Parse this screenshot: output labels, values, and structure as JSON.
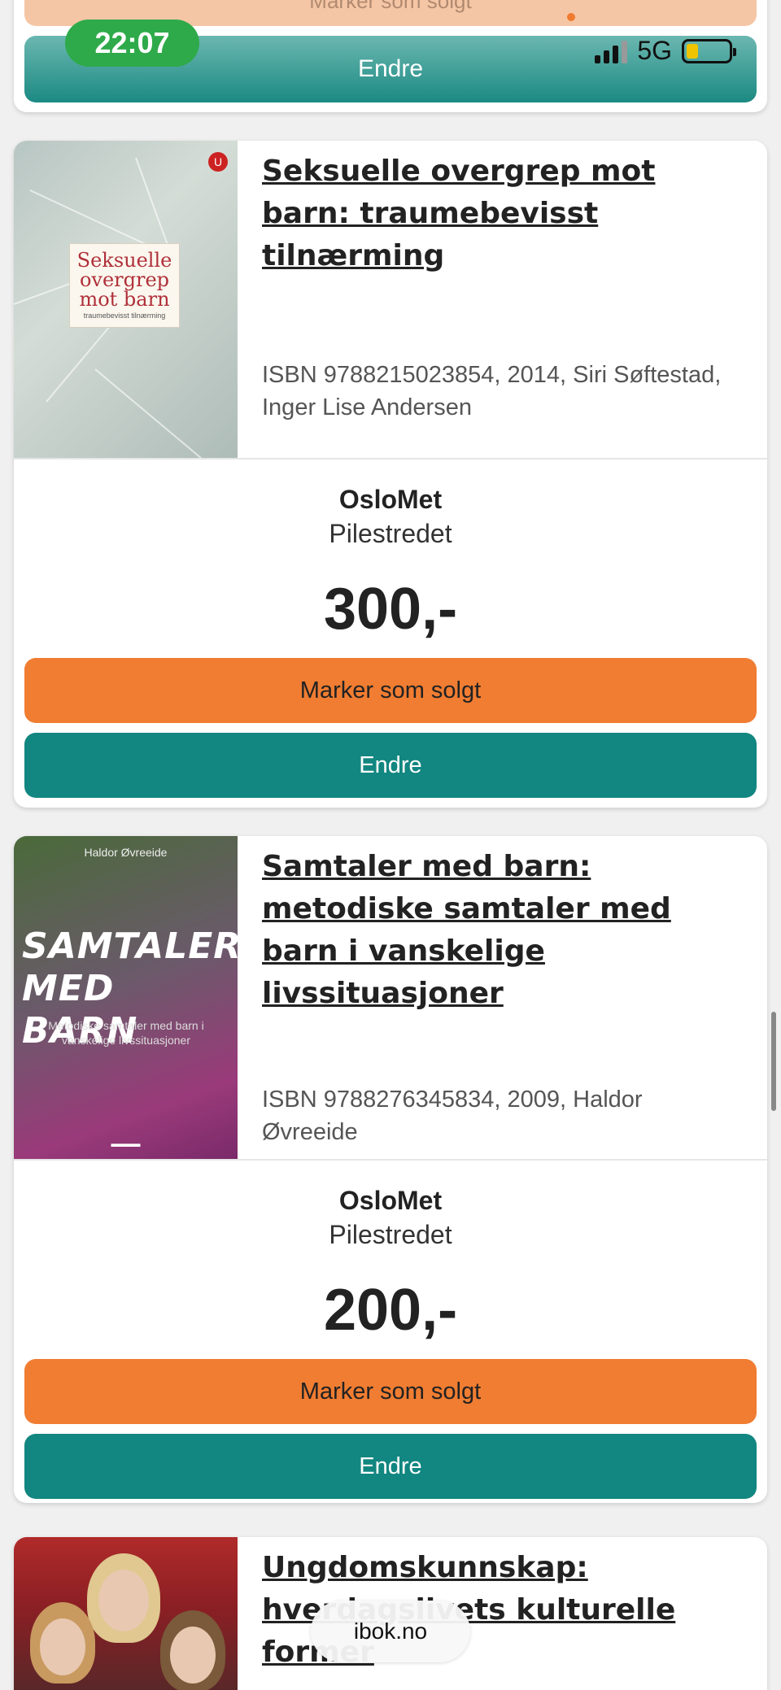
{
  "status_bar": {
    "time": "22:07",
    "network": "5G"
  },
  "top_card": {
    "sold_label": "Marker som solgt",
    "edit_label": "Endre"
  },
  "listings": [
    {
      "title": "Seksuelle overgrep mot barn: traumebevisst tilnærming",
      "meta": "ISBN 9788215023854, 2014, Siri Søftestad, Inger Lise Andersen",
      "school": "OsloMet",
      "campus": "Pilestredet",
      "price": "300,-",
      "sold_label": "Marker som solgt",
      "edit_label": "Endre",
      "cover": {
        "words": [
          "Seksuelle",
          "overgrep",
          "mot barn"
        ],
        "subtitle": "traumebevisst tilnærming"
      }
    },
    {
      "title": "Samtaler med barn: metodiske samtaler med barn i vanskelige livssituasjoner",
      "meta": "ISBN 9788276345834, 2009, Haldor Øvreeide",
      "school": "OsloMet",
      "campus": "Pilestredet",
      "price": "200,-",
      "sold_label": "Marker som solgt",
      "edit_label": "Endre",
      "cover": {
        "author": "Haldor Øvreeide",
        "line1": "SAMTALER",
        "line2": "MED BARN",
        "subtitle": "Metodiske samtaler med barn i vanskelige livssituasjoner"
      }
    },
    {
      "title": "Ungdomskunnskap: hverdagslivets kulturelle former"
    }
  ],
  "site": "ibok.no",
  "colors": {
    "orange": "#f07d32",
    "teal": "#128680",
    "status_green": "#2eaa4a"
  }
}
